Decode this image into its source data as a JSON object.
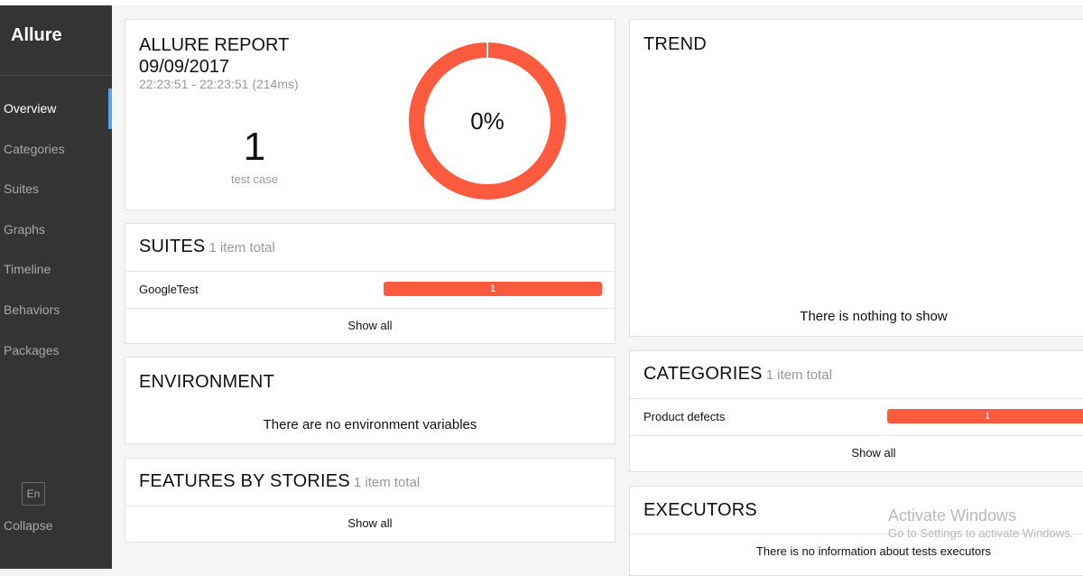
{
  "app": {
    "logo": "Allure"
  },
  "sidebar": {
    "items": [
      {
        "label": "Overview",
        "icon": "overview-icon",
        "active": true
      },
      {
        "label": "Categories",
        "icon": "categories-icon"
      },
      {
        "label": "Suites",
        "icon": "suites-icon"
      },
      {
        "label": "Graphs",
        "icon": "graphs-icon"
      },
      {
        "label": "Timeline",
        "icon": "timeline-icon"
      },
      {
        "label": "Behaviors",
        "icon": "behaviors-icon"
      },
      {
        "label": "Packages",
        "icon": "packages-icon"
      }
    ],
    "language": "En",
    "collapse_label": "Collapse"
  },
  "overview": {
    "title": "ALLURE REPORT",
    "date": "09/09/2017",
    "time_range": "22:23:51 - 22:23:51 (214ms)",
    "test_count": "1",
    "test_count_caption": "test case",
    "success_rate": "0%",
    "success_fraction": 0.0
  },
  "suites": {
    "title": "SUITES",
    "total": "1 item total",
    "rows": [
      {
        "label": "GoogleTest",
        "value": "1",
        "fraction": 1.0
      }
    ],
    "show_all": "Show all"
  },
  "environment": {
    "title": "ENVIRONMENT",
    "empty": "There are no environment variables"
  },
  "features": {
    "title": "FEATURES BY STORIES",
    "total": "1 item total",
    "show_all": "Show all"
  },
  "trend": {
    "title": "TREND",
    "empty": "There is nothing to show"
  },
  "categories": {
    "title": "CATEGORIES",
    "total": "1 item total",
    "rows": [
      {
        "label": "Product defects",
        "value": "1",
        "fraction": 1.0
      }
    ],
    "show_all": "Show all"
  },
  "executors": {
    "title": "EXECUTORS",
    "empty": "There is no information about tests executors"
  },
  "watermark": {
    "title": "Activate Windows",
    "subtitle": "Go to Settings to activate Windows."
  },
  "colors": {
    "sidebar_bg": "#343434",
    "active_indicator": "#5aa3e8",
    "failed": "#fd5a3e",
    "passed": "#97cc64"
  }
}
